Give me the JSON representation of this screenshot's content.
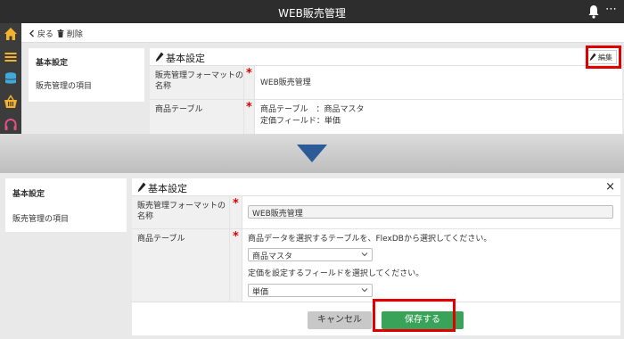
{
  "app": {
    "title": "WEB販売管理"
  },
  "toolbar": {
    "back_label": "戻る",
    "delete_label": "削除"
  },
  "sidebar": {
    "items": [
      {
        "label": "基本設定"
      },
      {
        "label": "販売管理の項目"
      }
    ]
  },
  "view_panel": {
    "title": "基本設定",
    "edit_label": "編集",
    "rows": [
      {
        "label": "販売管理フォーマットの名称",
        "value": "WEB販売管理"
      },
      {
        "label": "商品テーブル",
        "value_line1": "商品テーブル　：商品マスタ",
        "value_line2": "定価フィールド：単価"
      }
    ]
  },
  "edit_panel": {
    "title": "基本設定",
    "close_label": "×",
    "name_label": "販売管理フォーマットの名称",
    "name_value": "WEB販売管理",
    "table_label": "商品テーブル",
    "table_help": "商品データを選択するテーブルを、FlexDBから選択してください。",
    "table_select": "商品マスタ",
    "field_help": "定価を設定するフィールドを選択してください。",
    "field_select": "単価",
    "cancel_label": "キャンセル",
    "save_label": "保存する"
  },
  "required_mark": "*",
  "colors": {
    "titlebar": "#2d2d2d",
    "arrow": "#2b5c98",
    "save": "#3aa35a",
    "highlight": "#e00000"
  }
}
